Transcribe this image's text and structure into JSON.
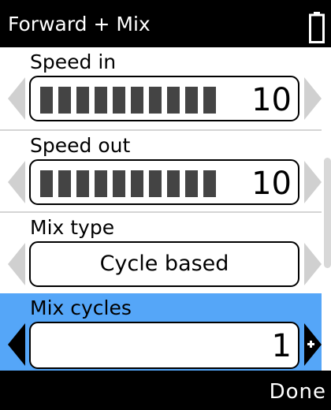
{
  "header": {
    "title": "Forward + Mix",
    "battery_icon": "battery-icon"
  },
  "settings": [
    {
      "label": "Speed in",
      "type": "bar",
      "bar_level": 10,
      "bar_max": 10,
      "value": "10"
    },
    {
      "label": "Speed out",
      "type": "bar",
      "bar_level": 10,
      "bar_max": 10,
      "value": "10"
    },
    {
      "label": "Mix type",
      "type": "select",
      "value": "Cycle based"
    },
    {
      "label": "Mix cycles",
      "type": "number",
      "value": "1",
      "selected": true
    }
  ],
  "footer": {
    "done_label": "Done"
  },
  "colors": {
    "selected_row": "#55a6f8",
    "bar_segment": "#444444",
    "disabled_arrow": "#d0d0d0"
  }
}
